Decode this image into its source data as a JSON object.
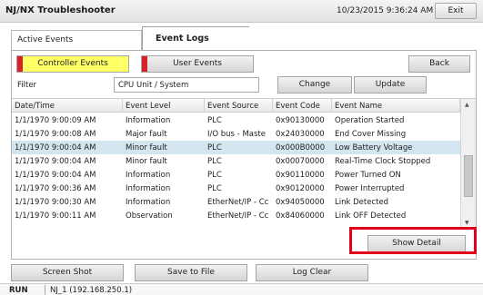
{
  "title": "NJ/NX Troubleshooter",
  "datetime": "10/23/2015 9:36:24 AM",
  "exit_label": "Exit",
  "tabs": [
    {
      "label": "Active Events",
      "active": false
    },
    {
      "label": "Event Logs",
      "active": true
    }
  ],
  "category_buttons": {
    "controller": "Controller Events",
    "user": "User Events",
    "back": "Back"
  },
  "filter": {
    "label": "Filter",
    "value": "CPU Unit / System",
    "change_label": "Change",
    "update_label": "Update"
  },
  "table": {
    "columns": [
      "Date/Time",
      "Event Level",
      "Event Source",
      "Event Code",
      "Event Name"
    ],
    "rows": [
      [
        "1/1/1970 9:00:09 AM",
        "Information",
        "PLC",
        "0x90130000",
        "Operation Started"
      ],
      [
        "1/1/1970 9:00:08 AM",
        "Major fault",
        "I/O bus - Maste",
        "0x24030000",
        "End Cover Missing"
      ],
      [
        "1/1/1970 9:00:04 AM",
        "Minor fault",
        "PLC",
        "0x000B0000",
        "Low Battery Voltage"
      ],
      [
        "1/1/1970 9:00:04 AM",
        "Minor fault",
        "PLC",
        "0x00070000",
        "Real-Time Clock Stopped"
      ],
      [
        "1/1/1970 9:00:04 AM",
        "Information",
        "PLC",
        "0x90110000",
        "Power Turned ON"
      ],
      [
        "1/1/1970 9:00:36 AM",
        "Information",
        "PLC",
        "0x90120000",
        "Power Interrupted"
      ],
      [
        "1/1/1970 9:00:30 AM",
        "Information",
        "EtherNet/IP - Cc",
        "0x94050000",
        "Link Detected"
      ],
      [
        "1/1/1970 9:00:11 AM",
        "Observation",
        "EtherNet/IP - Cc",
        "0x84060000",
        "Link OFF Detected"
      ]
    ],
    "selected_row": 2
  },
  "show_detail_label": "Show Detail",
  "bottom_buttons": {
    "screenshot": "Screen Shot",
    "save": "Save to File",
    "log_clear": "Log Clear"
  },
  "status": {
    "mode": "RUN",
    "connection": "NJ_1 (192.168.250.1)"
  },
  "colors": {
    "highlight": "#e2001a",
    "marker": "#d8222a",
    "controller_button": "#ffff66",
    "selected_row": "#d3e6f0"
  }
}
